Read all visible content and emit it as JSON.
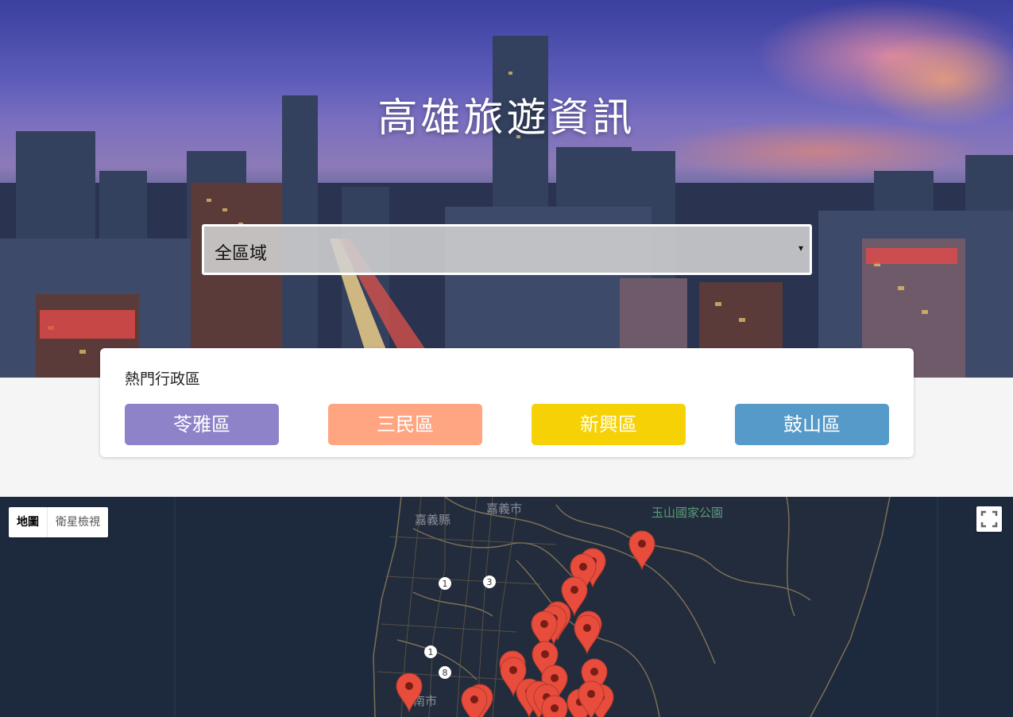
{
  "hero": {
    "title": "高雄旅遊資訊"
  },
  "filter": {
    "selected": "全區域",
    "arrow": "▾"
  },
  "popular": {
    "title": "熱門行政區",
    "districts": [
      {
        "label": "苓雅區",
        "color": "#8e82c9"
      },
      {
        "label": "三民區",
        "color": "#ffa582"
      },
      {
        "label": "新興區",
        "color": "#f5d105"
      },
      {
        "label": "鼓山區",
        "color": "#559ac8"
      }
    ]
  },
  "map": {
    "type_buttons": [
      "地圖",
      "衛星檢視"
    ],
    "place_labels": [
      "嘉義市",
      "嘉義縣",
      "玉山國家公園",
      "南市"
    ],
    "road_shields": [
      "1",
      "3",
      "1",
      "8"
    ],
    "marker_color": "#e74c3c"
  }
}
